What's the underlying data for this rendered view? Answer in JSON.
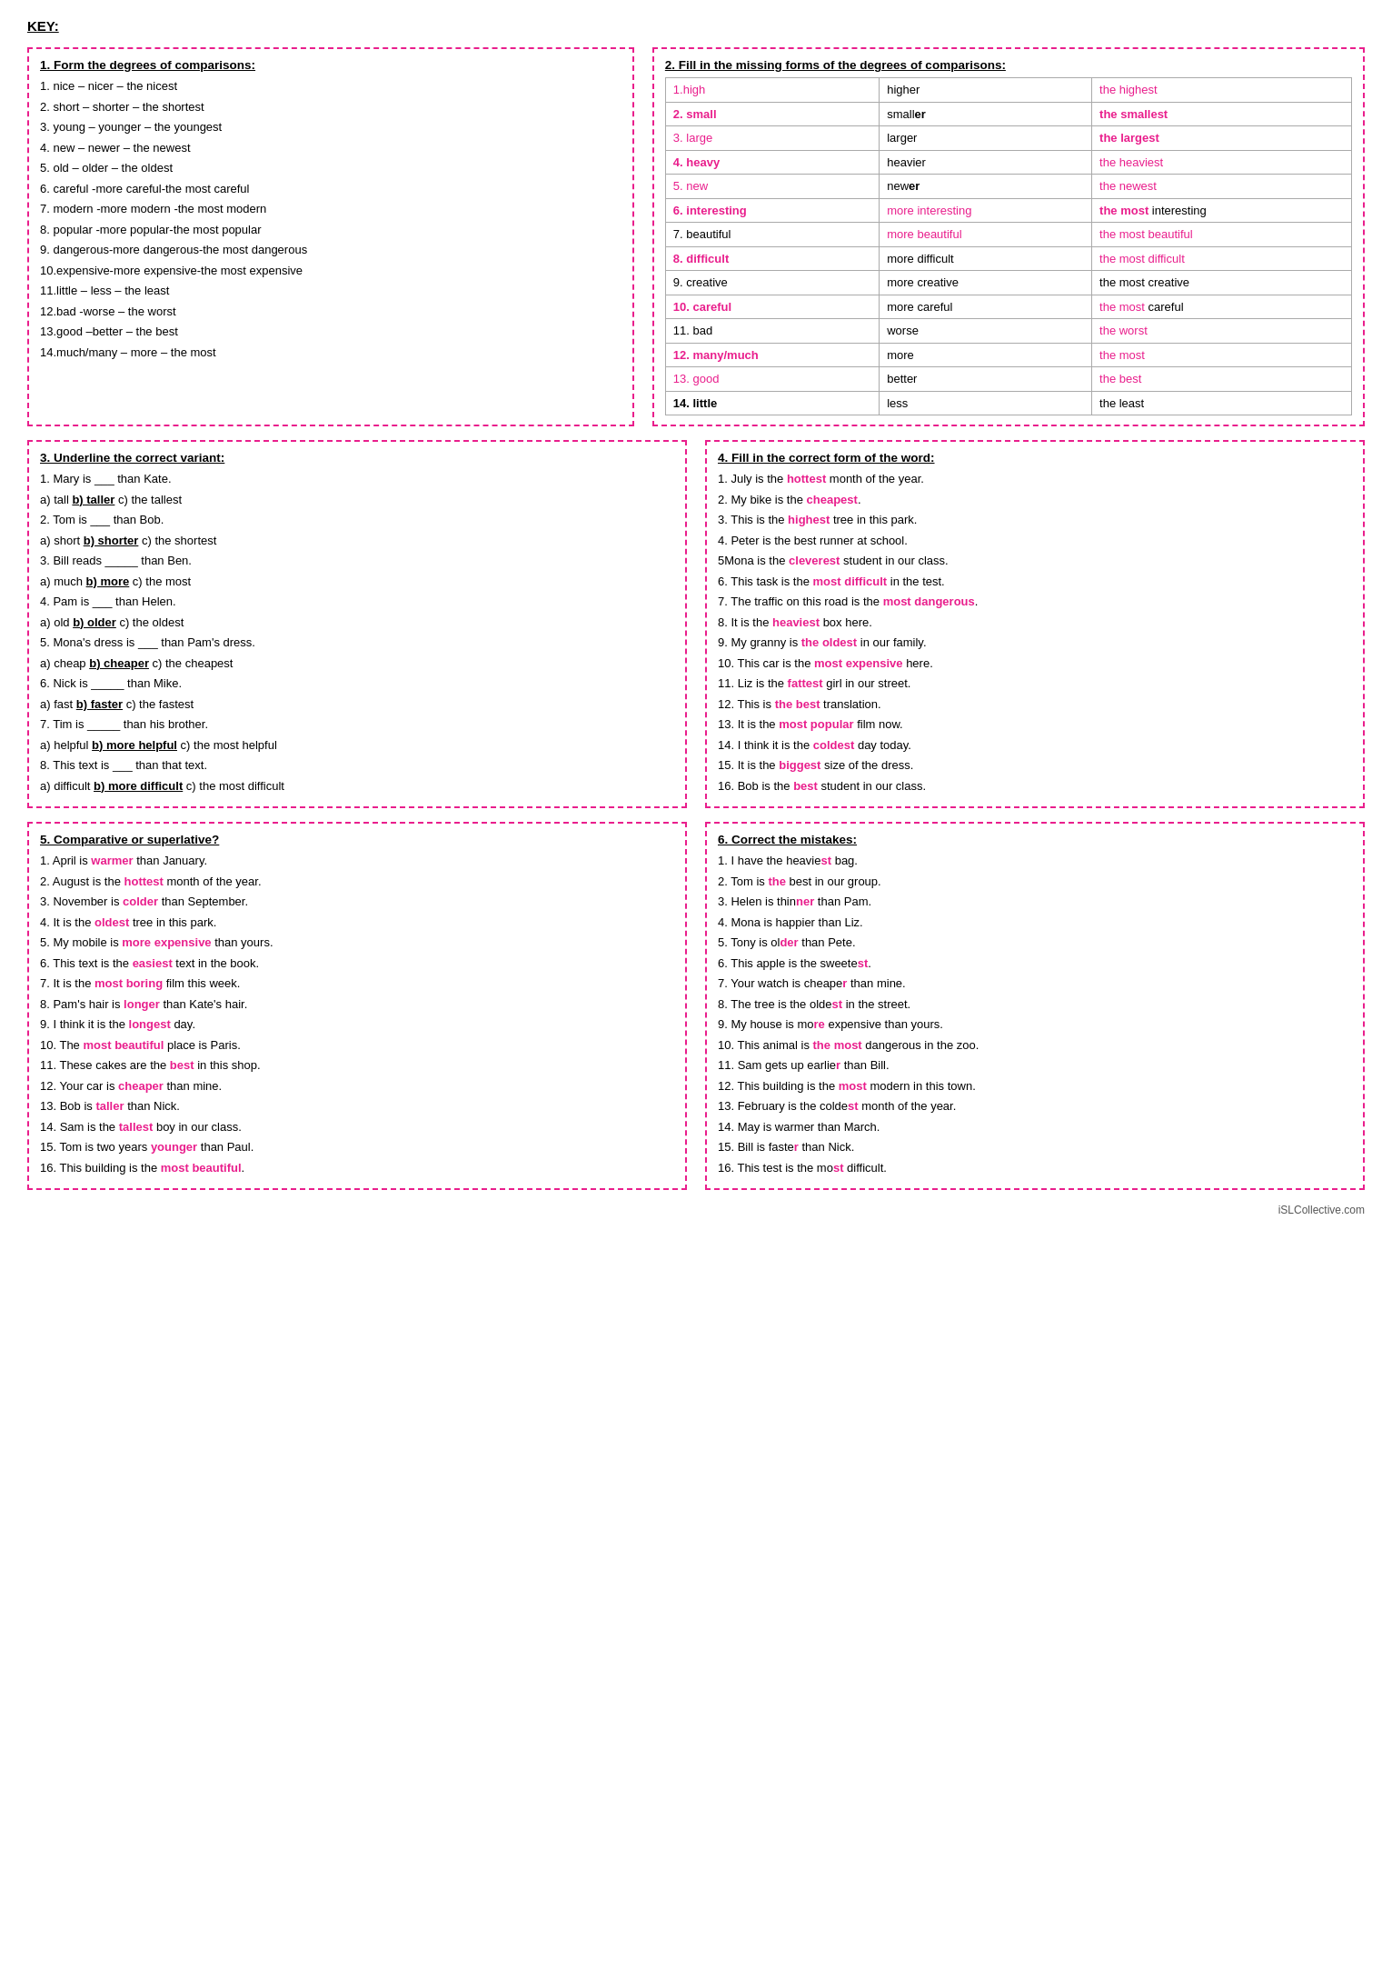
{
  "title": "KEY:",
  "section1": {
    "title": "1. Form the degrees of comparisons:",
    "lines": [
      "1. nice – nicer – the nicest",
      "2. short – shorter – the shortest",
      "3. young – younger – the youngest",
      "4. new – newer – the newest",
      "5. old – older – the oldest",
      "6. careful -more careful-the most careful",
      "7. modern -more modern -the most modern",
      "8. popular -more popular-the most popular",
      "9. dangerous-more dangerous-the most dangerous",
      "10.expensive-more expensive-the most expensive",
      "11.little – less – the least",
      "12.bad -worse – the worst",
      "13.good –better – the best",
      "14.much/many – more – the most"
    ]
  },
  "section2": {
    "title": "2. Fill in the missing forms of the degrees of comparisons:",
    "headers": [
      "",
      "",
      ""
    ],
    "rows": [
      {
        "col1": "1.high",
        "col2": "higher",
        "col3": "the highest",
        "c1pink": true,
        "c2plain": true,
        "c3pink": true
      },
      {
        "col1": "2. small",
        "col2": "smaller",
        "col3": "the smallest",
        "c1pink": true,
        "c2bold": true,
        "c3bold": true
      },
      {
        "col1": "3. large",
        "col2": "larger",
        "col3": "the largest",
        "c1pink": true,
        "c2plain": true,
        "c3bold": true
      },
      {
        "col1": "4. heavy",
        "col2": "heavier",
        "col3": "the heaviest",
        "c1pink": true,
        "c2plain": true,
        "c3pink": true
      },
      {
        "col1": "5. new",
        "col2": "newer",
        "col3": "the newest",
        "c1pink": true,
        "c2bold": true,
        "c3pink": true
      },
      {
        "col1": "6. interesting",
        "col2": "more interesting",
        "col3": "the most interesting",
        "c1pink": true,
        "c2pink": true,
        "c3mixed": "the most interesting"
      },
      {
        "col1": "7. beautiful",
        "col2": "more beautiful",
        "col3": "the most beautiful",
        "c1plain": true,
        "c2pink": true,
        "c3pink": true
      },
      {
        "col1": "8. difficult",
        "col2": "more difficult",
        "col3": "the most difficult",
        "c1pink": true,
        "c2bold": true,
        "c3pink": true
      },
      {
        "col1": "9. creative",
        "col2": "more creative",
        "col3": "the most creative",
        "c1plain": true,
        "c2plain": true,
        "c3plain": true
      },
      {
        "col1": "10. careful",
        "col2": "more careful",
        "col3": "the most careful",
        "c1pink": true,
        "c2plain": true,
        "c3mixed2": true
      },
      {
        "col1": "11. bad",
        "col2": "worse",
        "col3": "the worst",
        "c1plain": true,
        "c2plain": true,
        "c3pink": true
      },
      {
        "col1": "12. many/much",
        "col2": "more",
        "col3": "the most",
        "c1pink": true,
        "c2plain": true,
        "c3pink": true
      },
      {
        "col1": "13. good",
        "col2": "better",
        "col3": "the best",
        "c1pink": true,
        "c2plain": true,
        "c3pink": true
      },
      {
        "col1": "14. little",
        "col2": "less",
        "col3": "the least",
        "c1plain": true,
        "c2plain": true,
        "c3plain": true
      }
    ]
  },
  "section3": {
    "title": "3. Underline the correct variant:",
    "lines": [
      {
        "text": "1. Mary is ___ than Kate."
      },
      {
        "text": "a) tall   b) taller   c) the tallest",
        "bold_b": "b) taller"
      },
      {
        "text": "2. Tom is ___ than Bob."
      },
      {
        "text": "a) short   b) shorter   c) the shortest",
        "bold_b": "b) shorter"
      },
      {
        "text": "3. Bill reads _____ than Ben."
      },
      {
        "text": "a) much   b) more   c) the most",
        "bold_b": "b) more"
      },
      {
        "text": "4. Pam is ___ than Helen."
      },
      {
        "text": "a) old   b) older   c) the oldest",
        "bold_b": "b) older"
      },
      {
        "text": "5. Mona's dress is ___ than Pam's dress."
      },
      {
        "text": "a) cheap   b) cheaper   c) the cheapest",
        "bold_b": "b) cheaper"
      },
      {
        "text": "6. Nick is _____ than Mike."
      },
      {
        "text": "a) fast   b) faster   c) the fastest",
        "bold_b": "b) faster"
      },
      {
        "text": "7. Tim is _____ than his brother."
      },
      {
        "text": "a) helpful   b) more helpful   c) the most helpful",
        "bold_b": "b) more helpful"
      },
      {
        "text": "8. This text is ___ than that text."
      },
      {
        "text": "a) difficult   b) more difficult   c) the most difficult",
        "bold_b": "b) more difficult"
      }
    ]
  },
  "section4": {
    "title": "4. Fill in the correct form of the word:",
    "lines": [
      {
        "text": "1. July is the ",
        "highlight": "hottest",
        "rest": " month of the year."
      },
      {
        "text": "2. My bike is the ",
        "highlight": "cheapest",
        "rest": "."
      },
      {
        "text": "3. This is the ",
        "highlight": "highest",
        "rest": " tree in this park."
      },
      {
        "text": "4. Peter is the best runner at school."
      },
      {
        "text": "5Mona is the ",
        "highlight": "cleverest",
        "rest": " student in our class."
      },
      {
        "text": "6. This task is the ",
        "highlight": "most difficult",
        "rest": " in the test."
      },
      {
        "text": "7. The traffic on this road is the ",
        "highlight": "most dangerous",
        "rest": "."
      },
      {
        "text": "8. It is the ",
        "highlight": "heaviest",
        "rest": " box here."
      },
      {
        "text": "9. My granny is ",
        "highlight": "the oldest",
        "rest": " in our family."
      },
      {
        "text": "10. This car is the ",
        "highlight": "most expensive",
        "rest": " here."
      },
      {
        "text": "11. Liz is the ",
        "highlight": "fattest",
        "rest": " girl in our street."
      },
      {
        "text": "12. This is ",
        "highlight": "the best",
        "rest": " translation."
      },
      {
        "text": "13. It is the ",
        "highlight": "most popular",
        "rest": " film now."
      },
      {
        "text": "14. I think it is the ",
        "highlight": "coldest",
        "rest": " day today."
      },
      {
        "text": "15. It is the ",
        "highlight": "biggest",
        "rest": " size of the dress."
      },
      {
        "text": "16. Bob is the ",
        "highlight": "best",
        "rest": " student in our class."
      }
    ]
  },
  "section5": {
    "title": "5. Comparative or superlative?",
    "lines": [
      {
        "text": "1. April is ",
        "highlight": "warmer",
        "rest": " than January."
      },
      {
        "text": "2. August is the ",
        "highlight": "hottest",
        "rest": " month of the year."
      },
      {
        "text": "3. November is ",
        "highlight": "colder",
        "rest": " than September."
      },
      {
        "text": "4. It is the ",
        "highlight": "oldest",
        "rest": " tree in this park."
      },
      {
        "text": "5. My mobile is ",
        "highlight": "more expensive",
        "rest": " than yours."
      },
      {
        "text": "6. This text is the ",
        "highlight": "easiest",
        "rest": " text in the book."
      },
      {
        "text": "7. It is the ",
        "highlight": "most boring",
        "rest": " film this week."
      },
      {
        "text": "8. Pam's hair is ",
        "highlight": "longer",
        "rest": " than Kate's hair."
      },
      {
        "text": "9. I think it is the ",
        "highlight": "longest",
        "rest": " day."
      },
      {
        "text": "10. The ",
        "highlight": "most beautiful",
        "rest": " place is Paris."
      },
      {
        "text": "11. These cakes are the ",
        "highlight": "best",
        "rest": " in this shop."
      },
      {
        "text": "12. Your car is ",
        "highlight": "cheaper",
        "rest": " than mine."
      },
      {
        "text": "13. Bob is ",
        "highlight": "taller",
        "rest": " than Nick."
      },
      {
        "text": "14. Sam is the ",
        "highlight": "tallest",
        "rest": " boy in our class."
      },
      {
        "text": "15. Tom is two years ",
        "highlight": "younger",
        "rest": " than Paul."
      },
      {
        "text": "16. This building is the ",
        "highlight": "most beautiful",
        "rest": "."
      }
    ]
  },
  "section6": {
    "title": "6. Correct the mistakes:",
    "lines": [
      {
        "text": "1. I have the heavie",
        "highlight": "st",
        "rest": " bag."
      },
      {
        "text": "2. Tom is ",
        "highlight": "the",
        "rest": " best in our group."
      },
      {
        "text": "3. Helen is thin",
        "highlight": "ner",
        "rest": " than Pam."
      },
      {
        "text": "4. Mona is happier than Liz."
      },
      {
        "text": "5. Tony is ol",
        "highlight": "der",
        "rest": " than Pete."
      },
      {
        "text": "6. This apple is the sweete",
        "highlight": "st",
        "rest": "."
      },
      {
        "text": "7. Your watch is cheape",
        "highlight": "r",
        "rest": " than mine."
      },
      {
        "text": "8. The tree is the olde",
        "highlight": "st",
        "rest": " in the street."
      },
      {
        "text": "9. My house is mo",
        "highlight": "re",
        "rest": " expensive than yours."
      },
      {
        "text": "10. This animal is ",
        "highlight": "the most",
        "rest": " dangerous in the zoo."
      },
      {
        "text": "11. Sam gets up earlie",
        "highlight": "r",
        "rest": " than Bill."
      },
      {
        "text": "12. This building is the ",
        "highlight": "most",
        "rest": " modern in this town."
      },
      {
        "text": "13. February is the colde",
        "highlight": "st",
        "rest": " month of the year."
      },
      {
        "text": "14. May is warmer than March."
      },
      {
        "text": "15. Bill is faste",
        "highlight": "r",
        "rest": " than Nick."
      },
      {
        "text": "16. This test is the mo",
        "highlight": "st",
        "rest": " difficult."
      }
    ]
  },
  "footer": "iSLCollective.com"
}
